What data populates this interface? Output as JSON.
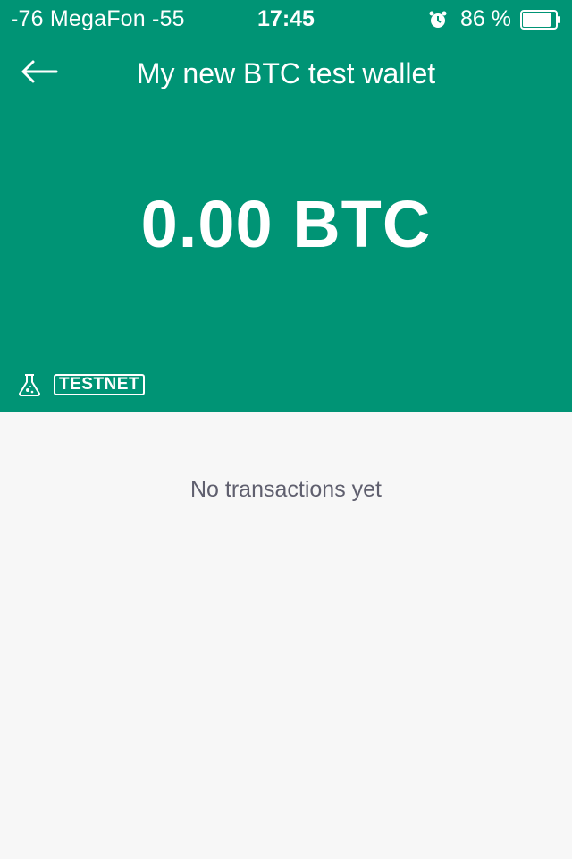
{
  "status_bar": {
    "carrier": "-76 MegaFon  -55",
    "time": "17:45",
    "battery_percent": "86 %",
    "battery_level": 0.86
  },
  "nav": {
    "title": "My new BTC test wallet",
    "back_icon": "arrow-left-icon"
  },
  "wallet": {
    "balance": "0.00 BTC",
    "network_label": "TESTNET",
    "network_icon": "flask-icon"
  },
  "transactions": {
    "empty_message": "No transactions yet"
  },
  "colors": {
    "header_bg": "#009475",
    "body_bg": "#f7f7f7",
    "empty_text": "#5f5f6e"
  }
}
